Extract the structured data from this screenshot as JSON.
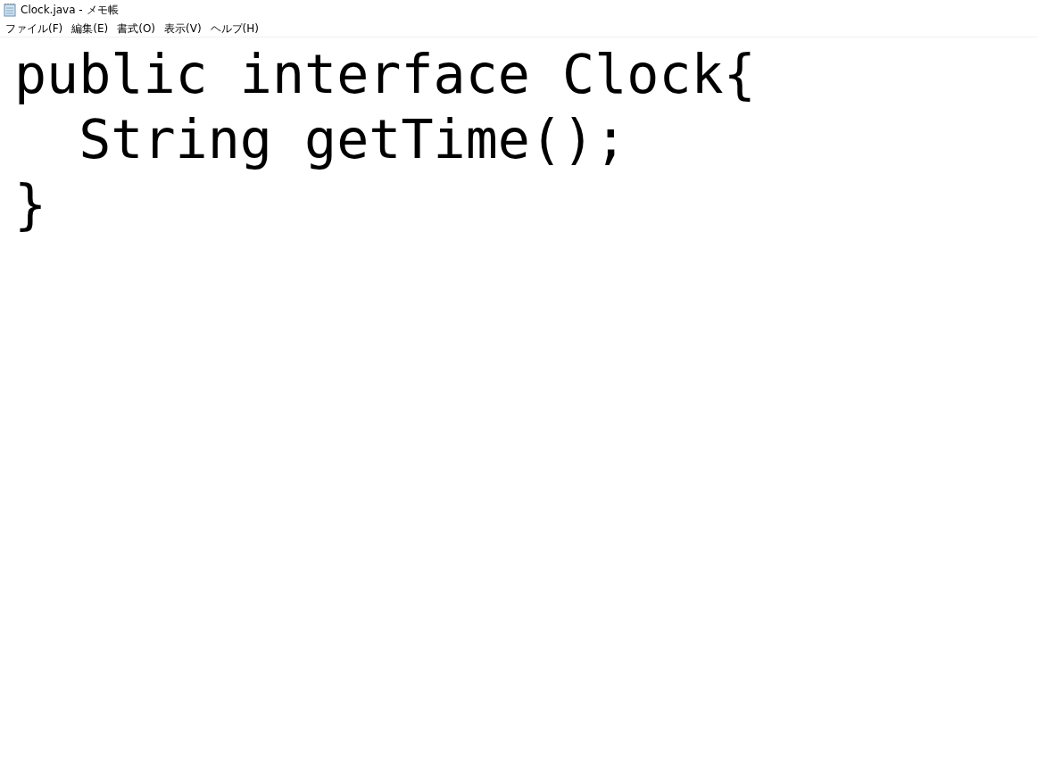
{
  "window": {
    "title": "Clock.java - メモ帳"
  },
  "menu": [
    "ファイル(F)",
    "編集(E)",
    "書式(O)",
    "表示(V)",
    "ヘルプ(H)"
  ],
  "editor": {
    "lines": [
      "public interface Clock{",
      "  String getTime();",
      "}"
    ]
  }
}
